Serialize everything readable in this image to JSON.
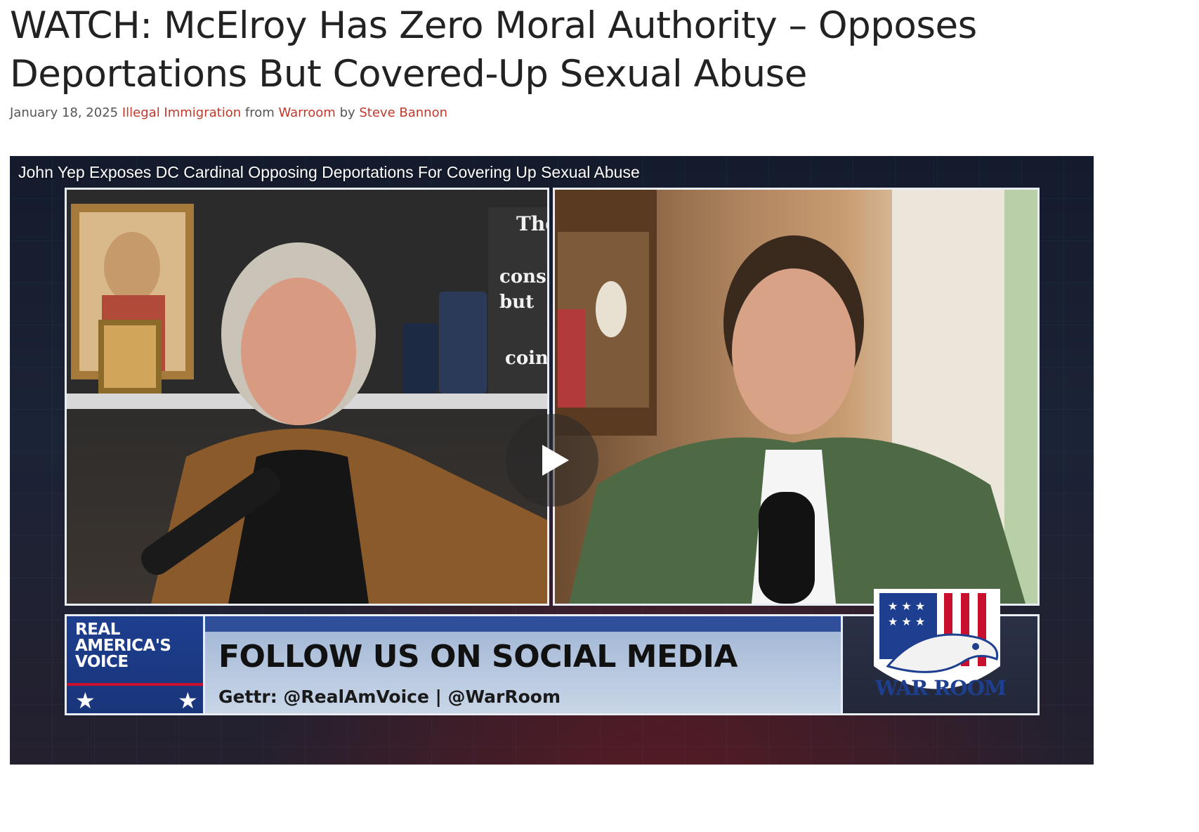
{
  "article": {
    "title": "WATCH: McElroy Has Zero Moral Authority – Opposes Deportations But Covered-Up Sexual Abuse",
    "date": "January 18, 2025",
    "category": "Illegal Immigration",
    "from_word": "from",
    "source": "Warroom",
    "by_word": "by",
    "author": "Steve Bannon"
  },
  "video": {
    "title": "John Yep Exposes DC Cardinal Opposing Deportations For Covering Up Sexual Abuse",
    "play_icon": "play-icon",
    "lower_third": {
      "network_logo": "REAL\nAMERICA'S\nVOICE",
      "headline": "FOLLOW US ON SOCIAL MEDIA",
      "subline": "Gettr: @RealAmVoice | @WarRoom",
      "show_logo_text": "WAR ROOM"
    },
    "shelf_sign_text": [
      "The",
      "cons",
      "but",
      "coin"
    ]
  },
  "colors": {
    "link": "#c0392b",
    "meta_text": "#555555",
    "title_text": "#222222",
    "banner_blue": "#1e3f8f"
  }
}
